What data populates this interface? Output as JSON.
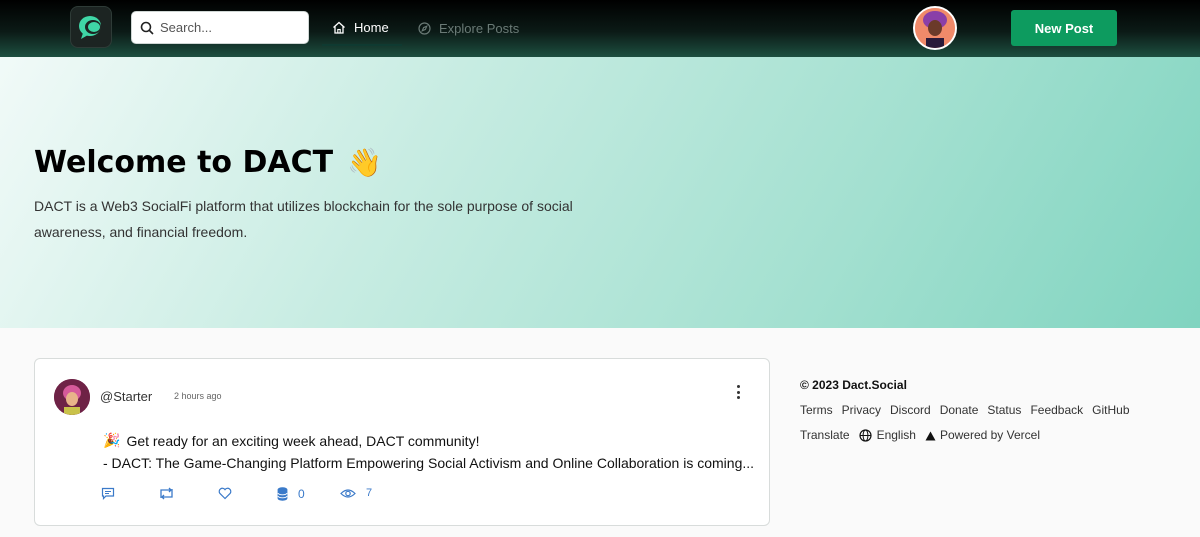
{
  "header": {
    "search_placeholder": "Search...",
    "nav_home": "Home",
    "nav_explore": "Explore Posts",
    "new_post_label": "New Post"
  },
  "hero": {
    "title": "Welcome to DACT",
    "emoji": "👋",
    "description": "DACT is a Web3 SocialFi platform that utilizes blockchain for the sole purpose of social awareness, and financial freedom."
  },
  "post": {
    "username": "@Starter",
    "time": "2 hours ago",
    "emoji": "🎉",
    "line1": "Get ready for an exciting week ahead, DACT community!",
    "line2": "- DACT: The Game-Changing Platform Empowering Social Activism and Online Collaboration is coming...",
    "coin_count": "0",
    "view_count": "7"
  },
  "footer": {
    "copyright": "© 2023 Dact.Social",
    "links": [
      "Terms",
      "Privacy",
      "Discord",
      "Donate",
      "Status",
      "Feedback",
      "GitHub",
      "Translate"
    ],
    "language": "English",
    "powered": "Powered by Vercel"
  },
  "colors": {
    "accent": "#0d9b5f",
    "action_blue": "#3b7ac9"
  },
  "icons": [
    "app-logo-icon",
    "search-icon",
    "home-icon",
    "compass-icon",
    "more-vertical-icon",
    "comment-icon",
    "repost-icon",
    "heart-icon",
    "coins-icon",
    "eye-icon",
    "globe-icon",
    "vercel-triangle-icon"
  ]
}
